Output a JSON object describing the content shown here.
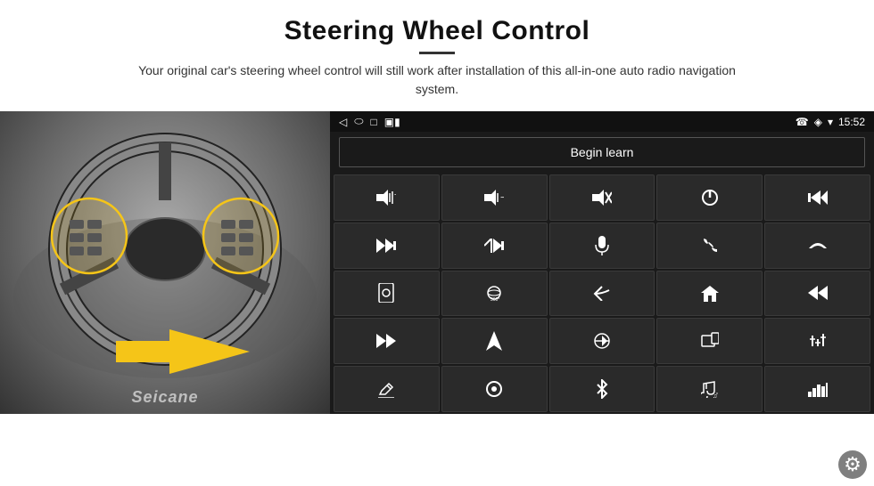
{
  "header": {
    "title": "Steering Wheel Control",
    "subtitle": "Your original car's steering wheel control will still work after installation of this all-in-one auto radio navigation system."
  },
  "status_bar": {
    "left_icons": [
      "◁",
      "⬭",
      "□",
      "▣"
    ],
    "time": "15:52",
    "right_icons": [
      "☎",
      "◈",
      "▾"
    ]
  },
  "begin_learn": {
    "label": "Begin learn"
  },
  "buttons": [
    {
      "icon": "🔊+",
      "name": "vol-up"
    },
    {
      "icon": "🔊−",
      "name": "vol-down"
    },
    {
      "icon": "🔇",
      "name": "mute"
    },
    {
      "icon": "⏻",
      "name": "power"
    },
    {
      "icon": "⏮",
      "name": "prev-track"
    },
    {
      "icon": "⏭",
      "name": "next"
    },
    {
      "icon": "⇥⏭",
      "name": "skip"
    },
    {
      "icon": "🎤",
      "name": "mic"
    },
    {
      "icon": "☎",
      "name": "call"
    },
    {
      "icon": "↩",
      "name": "hang-up"
    },
    {
      "icon": "📱",
      "name": "phone-mode"
    },
    {
      "icon": "⊙360",
      "name": "camera-360"
    },
    {
      "icon": "↺",
      "name": "back"
    },
    {
      "icon": "⌂",
      "name": "home"
    },
    {
      "icon": "⏮⏮",
      "name": "rewind"
    },
    {
      "icon": "⏭⏭",
      "name": "fast-forward"
    },
    {
      "icon": "◭",
      "name": "navigation"
    },
    {
      "icon": "⇄",
      "name": "swap"
    },
    {
      "icon": "🎵",
      "name": "media"
    },
    {
      "icon": "⚙",
      "name": "eq"
    },
    {
      "icon": "✏",
      "name": "edit"
    },
    {
      "icon": "⊙",
      "name": "circle"
    },
    {
      "icon": "✱",
      "name": "bluetooth"
    },
    {
      "icon": "🎵",
      "name": "music"
    },
    {
      "icon": "📶",
      "name": "signal"
    }
  ],
  "watermark": "Seicane",
  "gear": "⚙"
}
